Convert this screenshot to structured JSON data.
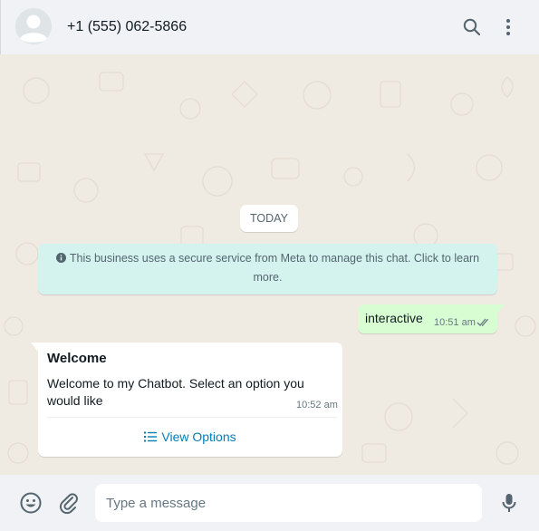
{
  "header": {
    "contact_name": "+1 (555) 062-5866",
    "icons": [
      "avatar-icon",
      "search-icon",
      "menu-icon"
    ]
  },
  "chat": {
    "date_label": "TODAY",
    "system_message": "This business uses a secure service from Meta to manage this chat. Click to learn more.",
    "outgoing": {
      "text": "interactive",
      "time": "10:51 am",
      "status": "read"
    },
    "incoming": {
      "title": "Welcome",
      "body": "Welcome to my Chatbot. Select an option you would like",
      "time": "10:52 am",
      "button_label": "View Options"
    }
  },
  "composer": {
    "placeholder": "Type a message",
    "value": "",
    "icons": [
      "emoji-icon",
      "attach-icon",
      "mic-icon"
    ]
  },
  "colors": {
    "header_bg": "#f0f2f5",
    "chat_bg": "#efeae2",
    "outgoing_bubble": "#d9fdd3",
    "system_bubble": "#d4f3ef",
    "link": "#027eb5",
    "read_ticks": "#667781"
  }
}
